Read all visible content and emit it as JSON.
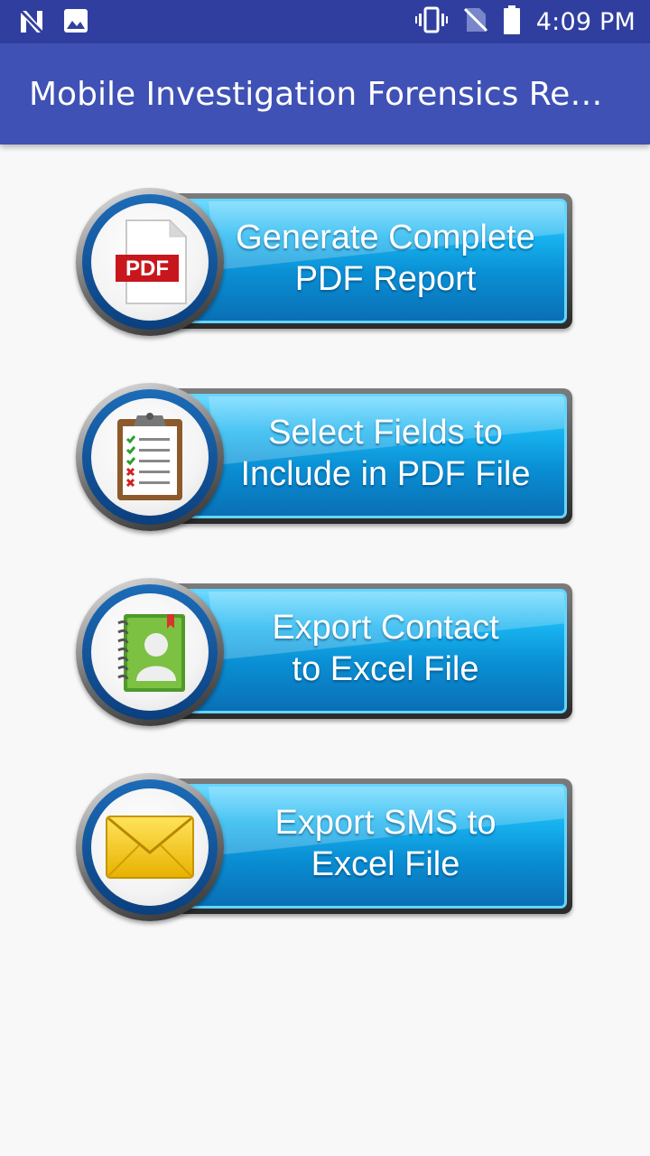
{
  "status_bar": {
    "time": "4:09 PM",
    "left_icons": [
      "notification-n-icon",
      "image-icon"
    ],
    "right_icons": [
      "vibrate-icon",
      "no-sim-icon",
      "battery-icon"
    ]
  },
  "app_bar": {
    "title": "Mobile Investigation Forensics Re…"
  },
  "menu": [
    {
      "line1": "Generate Complete",
      "line2": "PDF Report",
      "icon": "pdf-file-icon",
      "badge": "PDF"
    },
    {
      "line1": "Select Fields to",
      "line2": "Include in PDF File",
      "icon": "clipboard-checklist-icon"
    },
    {
      "line1": "Export Contact",
      "line2": "to Excel File",
      "icon": "contact-book-icon"
    },
    {
      "line1": "Export SMS to",
      "line2": "Excel File",
      "icon": "envelope-icon"
    }
  ],
  "colors": {
    "status_bar": "#303f9f",
    "app_bar": "#3f51b5",
    "background": "#f8f8f8",
    "button_blue": "#0a8fd4",
    "button_highlight": "#63d6ff",
    "ring_blue": "#1c6cb8"
  }
}
